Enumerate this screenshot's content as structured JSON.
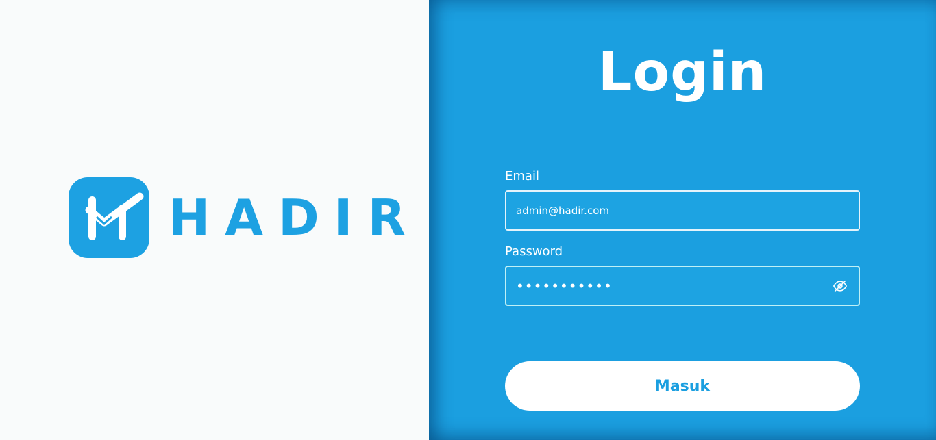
{
  "brand": {
    "name": "HADIR",
    "logo_icon": "hadir-h-check-icon",
    "color": "#1da1e2"
  },
  "login": {
    "title": "Login",
    "email": {
      "label": "Email",
      "value": "admin@hadir.com"
    },
    "password": {
      "label": "Password",
      "value": "adminpass12",
      "toggle_icon": "eye-off-icon"
    },
    "submit_label": "Masuk"
  },
  "colors": {
    "panel_background": "#1b9fe0",
    "left_background": "#f9fbfb",
    "text_on_panel": "#ffffff"
  }
}
